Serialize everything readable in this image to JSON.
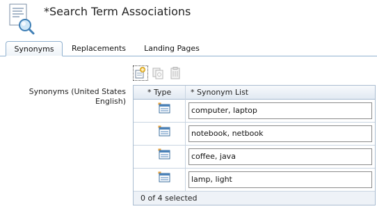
{
  "page": {
    "title": "*Search Term Associations"
  },
  "tabs": [
    {
      "label": "Synonyms",
      "active": true
    },
    {
      "label": "Replacements",
      "active": false
    },
    {
      "label": "Landing Pages",
      "active": false
    }
  ],
  "toolbar": {
    "icons": [
      "new-synonym-icon",
      "copy-icon",
      "delete-icon"
    ]
  },
  "field": {
    "label": "Synonyms (United States English)"
  },
  "grid": {
    "columns": [
      "* Type",
      "* Synonym List"
    ],
    "rows": [
      {
        "type_icon": "synonym-type-icon",
        "value": "computer, laptop"
      },
      {
        "type_icon": "synonym-type-icon",
        "value": "notebook, netbook"
      },
      {
        "type_icon": "synonym-type-icon",
        "value": "coffee, java"
      },
      {
        "type_icon": "synonym-type-icon",
        "value": "lamp, light"
      }
    ],
    "status": "0 of 4 selected"
  },
  "colors": {
    "border": "#a9bcd0",
    "tab_border": "#8fb0cf",
    "header_bg": "#e1e9f2"
  }
}
